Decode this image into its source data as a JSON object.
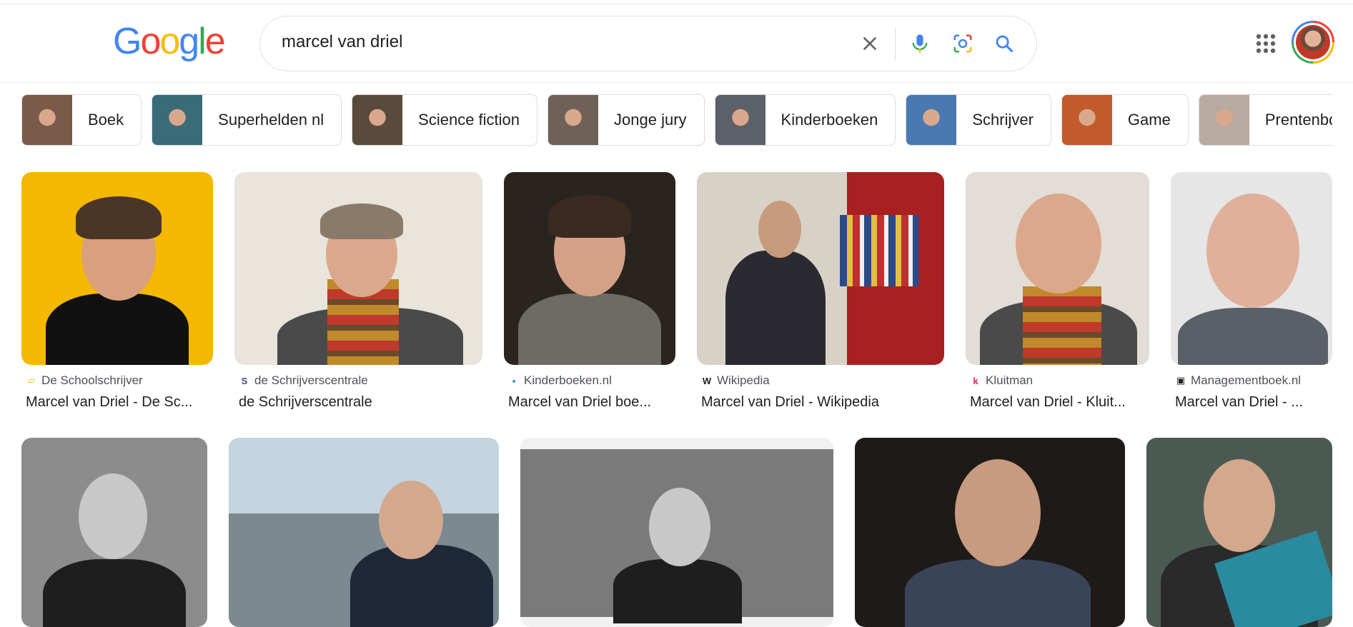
{
  "logo": {
    "text": "Google",
    "letters": [
      "G",
      "o",
      "o",
      "g",
      "l",
      "e"
    ],
    "colors": [
      "#4285f4",
      "#ea4335",
      "#fbbc05",
      "#4285f4",
      "#34a853",
      "#ea4335"
    ]
  },
  "search": {
    "value": "marcel van driel"
  },
  "icons": {
    "clear": "close-icon",
    "voice": "microphone-icon",
    "lens": "camera-lens-icon",
    "search": "search-icon",
    "apps": "apps-grid-icon"
  },
  "chips": [
    {
      "label": "Boek",
      "thumb": "#7a5a48"
    },
    {
      "label": "Superhelden nl",
      "thumb": "#3a6b78"
    },
    {
      "label": "Science fiction",
      "thumb": "#5a4a3c"
    },
    {
      "label": "Jonge jury",
      "thumb": "#6e6258"
    },
    {
      "label": "Kinderboeken",
      "thumb": "#5c6068"
    },
    {
      "label": "Schrijver",
      "thumb": "#4a78b0"
    },
    {
      "label": "Game",
      "thumb": "#c25a2a"
    },
    {
      "label": "Prentenboeken",
      "thumb": "#b8aaa0"
    }
  ],
  "results_row1": [
    {
      "source": "De Schoolschrijver",
      "caption": "Marcel van Driel - De Sc...",
      "source_icon_color": "#f5b800",
      "bg": "#f5b800"
    },
    {
      "source": "de Schrijverscentrale",
      "caption": "de Schrijverscentrale",
      "source_icon_color": "#3c4a8c",
      "bg": "#e9e4dc"
    },
    {
      "source": "Kinderboeken.nl",
      "caption": "Marcel van Driel boe...",
      "source_icon_color": "#1a73a8",
      "bg": "#2a2420"
    },
    {
      "source": "Wikipedia",
      "caption": "Marcel van Driel - Wikipedia",
      "source_icon_color": "#ffffff",
      "bg": "#d8d2c6"
    },
    {
      "source": "Kluitman",
      "caption": "Marcel van Driel - Kluit...",
      "source_icon_color": "#e0245e",
      "bg": "#e2ddd6"
    },
    {
      "source": "Managementboek.nl",
      "caption": "Marcel van Driel - ...",
      "source_icon_color": "#202124",
      "bg": "#e6e6e6"
    }
  ],
  "source_icon_glyphs": [
    "▱",
    "S",
    "▪",
    "W",
    "k",
    "▣"
  ],
  "results_row2_bgs": [
    "#8c8c8c",
    "#9fb3c4",
    "#7a7a7a",
    "#1e1a18",
    "#4a5a52"
  ]
}
